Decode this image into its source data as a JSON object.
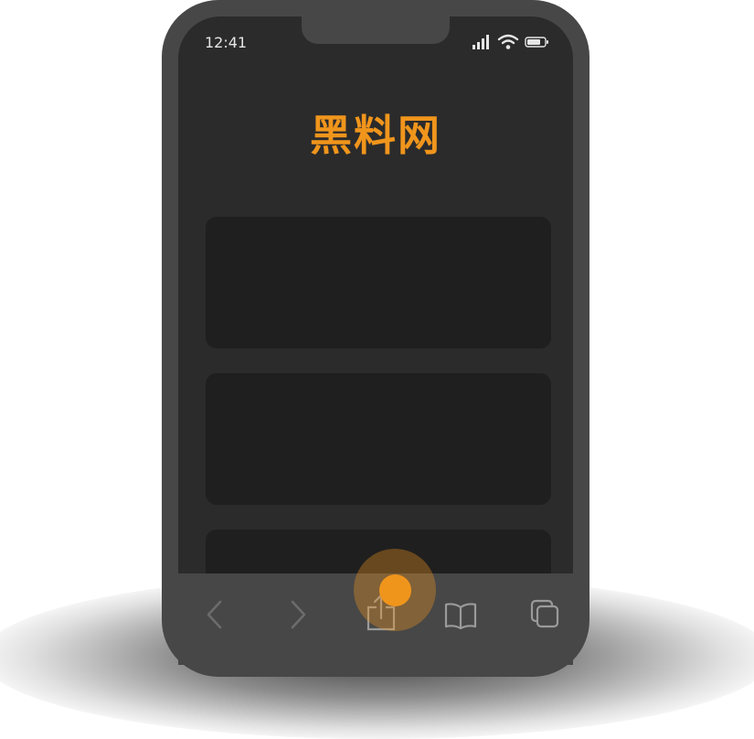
{
  "status_bar": {
    "time": "12:41"
  },
  "app": {
    "title": "黑料网"
  },
  "colors": {
    "accent": "#f0951c",
    "screen_bg": "#2b2b2b",
    "card_bg": "#1f1f1f",
    "frame": "#474747"
  },
  "toolbar": {
    "icons": [
      "back-icon",
      "forward-icon",
      "share-icon",
      "bookmarks-icon",
      "tabs-icon"
    ]
  }
}
